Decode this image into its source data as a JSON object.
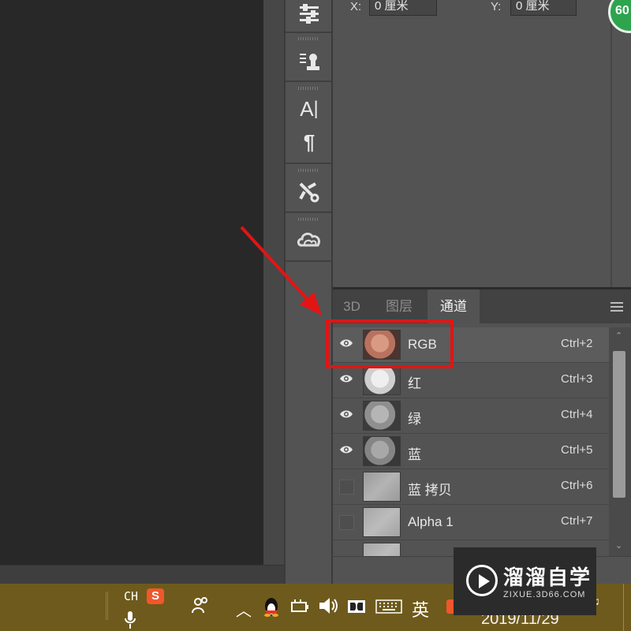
{
  "properties": {
    "x_label": "X:",
    "x_value": "0 厘米",
    "y_label": "Y:",
    "y_value": "0 厘米",
    "badge_text": "60"
  },
  "toolbar": {
    "icons": [
      "adjustments-icon",
      "clone-source-icon",
      "character-icon",
      "paragraph-icon",
      "tool-presets-icon",
      "libraries-icon"
    ]
  },
  "tabs": [
    {
      "label": "3D",
      "active": false
    },
    {
      "label": "图层",
      "active": false
    },
    {
      "label": "通道",
      "active": true
    }
  ],
  "channels": [
    {
      "name": "RGB",
      "shortcut": "Ctrl+2",
      "visible": true,
      "thumb": "color"
    },
    {
      "name": "红",
      "shortcut": "Ctrl+3",
      "visible": true,
      "thumb": "red"
    },
    {
      "name": "绿",
      "shortcut": "Ctrl+4",
      "visible": true,
      "thumb": "green"
    },
    {
      "name": "蓝",
      "shortcut": "Ctrl+5",
      "visible": true,
      "thumb": "blue"
    },
    {
      "name": "蓝 拷贝",
      "shortcut": "Ctrl+6",
      "visible": false,
      "thumb": "copy"
    },
    {
      "name": "Alpha 1",
      "shortcut": "Ctrl+7",
      "visible": false,
      "thumb": "alpha"
    }
  ],
  "taskbar": {
    "lang": "CH",
    "ime_label": "英",
    "clock_date": "2019/11/29"
  },
  "watermark": {
    "title": "溜溜自学",
    "url": "ZIXUE.3D66.COM"
  },
  "colors": {
    "highlight": "#e31414",
    "taskbar": "#6e5a1c",
    "badge": "#2ea44f"
  }
}
